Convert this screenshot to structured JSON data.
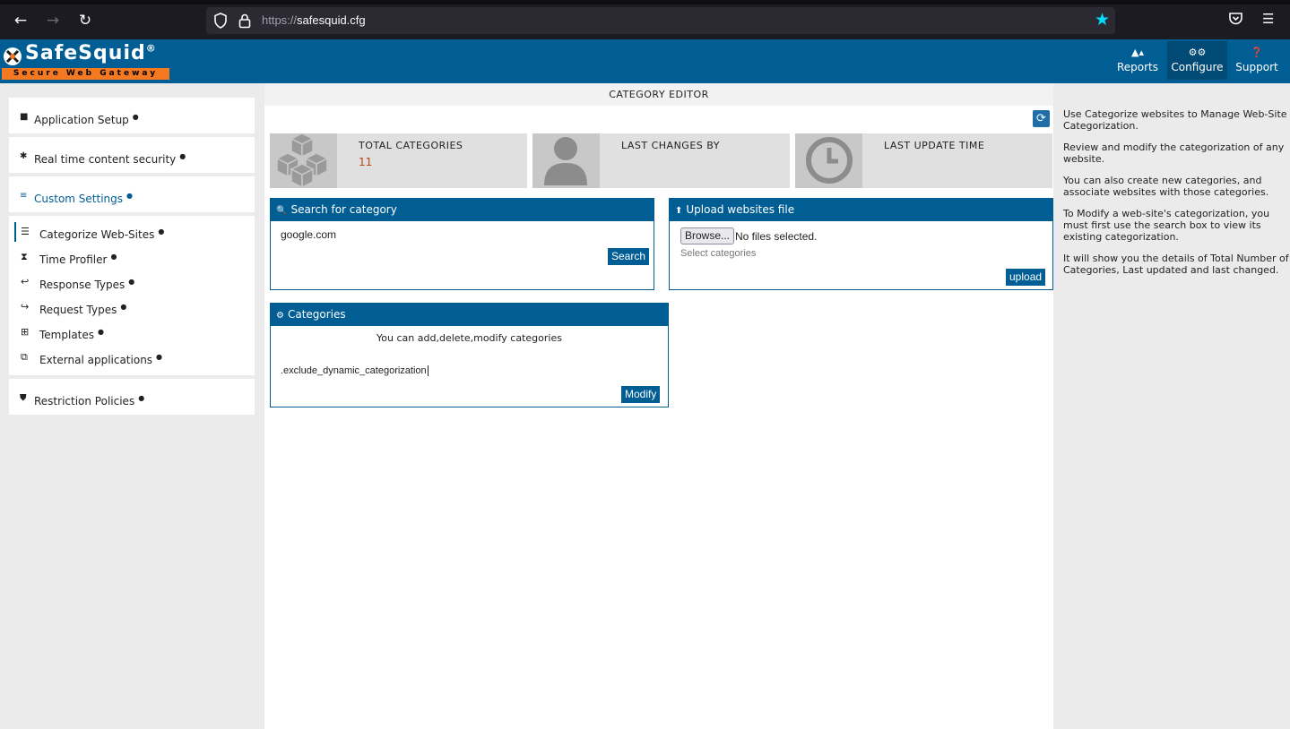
{
  "browser": {
    "url_scheme": "https://",
    "url_host": "safesquid.cfg"
  },
  "app": {
    "logo_name": "SafeSquid",
    "logo_mark": "®",
    "logo_tagline": "Secure Web Gateway",
    "nav": [
      {
        "label": "Reports",
        "icon": "area-chart-icon"
      },
      {
        "label": "Configure",
        "icon": "gears-icon"
      },
      {
        "label": "Support",
        "icon": "question-circle-icon"
      }
    ]
  },
  "sidebar": {
    "sections": [
      {
        "label": "Application Setup",
        "icon": "briefcase-icon"
      },
      {
        "label": "Real time content security",
        "icon": "bug-icon"
      },
      {
        "label": "Custom Settings",
        "icon": "sliders-icon"
      },
      {
        "label": "Restriction Policies",
        "icon": "shield-icon"
      }
    ],
    "sub_items": [
      {
        "label": "Categorize Web-Sites",
        "icon": "database-icon"
      },
      {
        "label": "Time Profiler",
        "icon": "hourglass-icon"
      },
      {
        "label": "Response Types",
        "icon": "reply-icon"
      },
      {
        "label": "Request Types",
        "icon": "share-icon"
      },
      {
        "label": "Templates",
        "icon": "sitemap-icon"
      },
      {
        "label": "External applications",
        "icon": "external-link-icon"
      }
    ]
  },
  "main": {
    "title": "CATEGORY EDITOR",
    "stats": [
      {
        "label": "TOTAL CATEGORIES",
        "value": "11",
        "icon": "cubes-icon"
      },
      {
        "label": "LAST CHANGES BY",
        "value": "",
        "icon": "user-icon"
      },
      {
        "label": "LAST UPDATE TIME",
        "value": "",
        "icon": "clock-icon"
      }
    ],
    "search_panel": {
      "title": "Search for category",
      "input_value": "google.com",
      "button": "Search"
    },
    "upload_panel": {
      "title": "Upload websites file",
      "browse": "Browse...",
      "file_status": "No files selected.",
      "select_placeholder": "Select categories",
      "button": "upload"
    },
    "categories_panel": {
      "title": "Categories",
      "description": "You can add,delete,modify categories",
      "input_value": ".exclude_dynamic_categorization",
      "button": "Modify"
    }
  },
  "help": [
    "Use Categorize websites to Manage Web-Site Categorization.",
    "Review and modify the categorization of any website.",
    "You can also create new categories, and associate websites with those categories.",
    "To Modify a web-site's categorization, you must first use the search box to view its existing categorization.",
    "It will show you the details of Total Number of Categories, Last updated and last changed."
  ],
  "colors": {
    "brand_blue": "#005e95",
    "brand_orange": "#f47920",
    "value_red": "#b5451b"
  }
}
